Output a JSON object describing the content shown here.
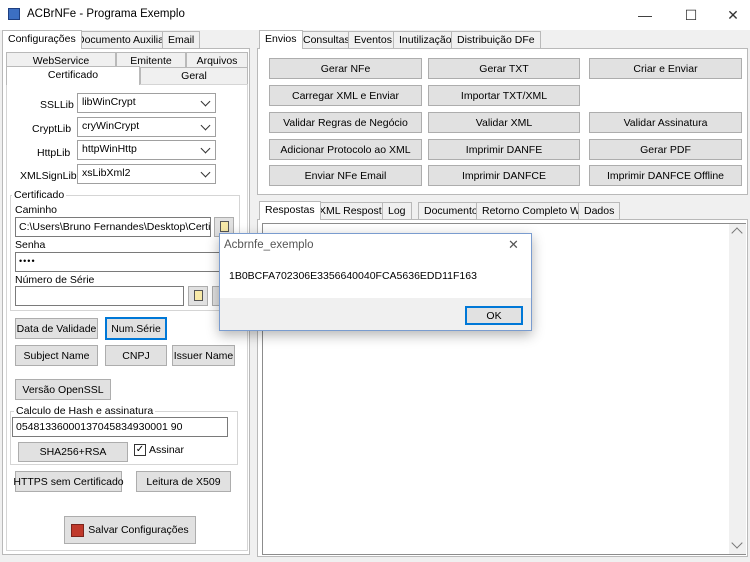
{
  "window": {
    "title": "ACBrNFe - Programa Exemplo",
    "minimize": "—",
    "maximize": "☐",
    "close": "✕"
  },
  "left_tabs": {
    "top": [
      "Configurações",
      "Documento Auxiliar",
      "Email"
    ],
    "row1": [
      "WebService",
      "Emitente",
      "Arquivos"
    ],
    "row2": [
      "Certificado",
      "Geral"
    ]
  },
  "libs": [
    {
      "label": "SSLLib",
      "value": "libWinCrypt"
    },
    {
      "label": "CryptLib",
      "value": "cryWinCrypt"
    },
    {
      "label": "HttpLib",
      "value": "httpWinHttp"
    },
    {
      "label": "XMLSignLib",
      "value": "xsLibXml2"
    }
  ],
  "certificado": {
    "group_title": "Certificado",
    "caminho_label": "Caminho",
    "caminho_value": "C:\\Users\\Bruno Fernandes\\Desktop\\Certificac",
    "senha_label": "Senha",
    "senha_value": "••••",
    "serie_label": "Número de Série",
    "serie_value": ""
  },
  "cert_buttons": {
    "validade": "Data de Validade",
    "num_serie": "Num.Série",
    "subject": "Subject Name",
    "cnpj": "CNPJ",
    "issuer": "Issuer Name",
    "openssl": "Versão OpenSSL"
  },
  "hash": {
    "group_title": "Calculo de Hash e assinatura",
    "value": "05481336000137045834930001 90",
    "sha_button": "SHA256+RSA",
    "assinar_label": "Assinar",
    "assinar_checked": "✓"
  },
  "bottom_buttons": {
    "https": "HTTPS sem Certificado",
    "x509": "Leitura de X509",
    "salvar": "Salvar Configurações"
  },
  "right_tabs": [
    "Envios",
    "Consultas",
    "Eventos",
    "Inutilização",
    "Distribuição DFe"
  ],
  "envio_buttons": [
    [
      "Gerar NFe",
      "Gerar TXT",
      "Criar e Enviar"
    ],
    [
      "Carregar XML e Enviar",
      "Importar TXT/XML",
      ""
    ],
    [
      "Validar Regras de Negócio",
      "Validar XML",
      "Validar Assinatura"
    ],
    [
      "Adicionar Protocolo ao XML",
      "Imprimir DANFE",
      "Gerar PDF"
    ],
    [
      "Enviar NFe Email",
      "Imprimir DANFCE",
      "Imprimir DANFCE Offline"
    ]
  ],
  "result_tabs": [
    "Respostas",
    "XML Resposta",
    "Log",
    "Documento",
    "Retorno Completo WS",
    "Dados"
  ],
  "dialog": {
    "title": "Acbrnfe_exemplo",
    "message": "1B0BCFA702306E3356640040FCA5636EDD11F163",
    "ok": "OK",
    "close": "✕"
  }
}
